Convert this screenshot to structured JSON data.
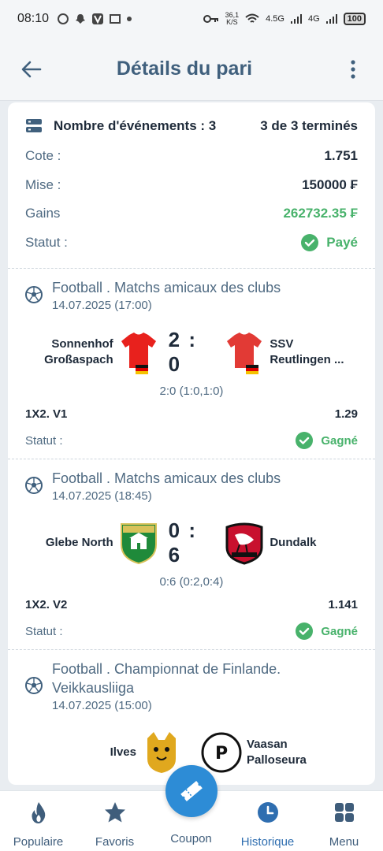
{
  "status_bar": {
    "time": "08:10",
    "net_speed_top": "36,1",
    "net_speed_unit": "K/S",
    "signal_1": "4.5G",
    "signal_2": "4G",
    "battery": "100"
  },
  "header": {
    "title": "Détails du pari"
  },
  "summary": {
    "events_label": "Nombre d'événements : 3",
    "finished_label": "3 de 3 terminés",
    "rows": [
      {
        "label": "Cote :",
        "value": "1.751"
      },
      {
        "label": "Mise :",
        "value": "150000 ₣"
      },
      {
        "label": "Gains",
        "value": "262732.35 ₣"
      }
    ],
    "status_label": "Statut :",
    "status_value": "Payé"
  },
  "events": [
    {
      "title": "Football . Matchs amicaux des clubs",
      "date": "14.07.2025 (17:00)",
      "home": "Sonnenhof Großaspach",
      "away": "SSV Reutlingen ...",
      "score": "2 : 0",
      "detail": "2:0 (1:0,1:0)",
      "bet_type": "1X2. V1",
      "odd": "1.29",
      "status_label": "Statut :",
      "status_value": "Gagné"
    },
    {
      "title": "Football . Matchs amicaux des clubs",
      "date": "14.07.2025 (18:45)",
      "home": "Glebe North",
      "away": "Dundalk",
      "score": "0 : 6",
      "detail": "0:6 (0:2,0:4)",
      "bet_type": "1X2. V2",
      "odd": "1.141",
      "status_label": "Statut :",
      "status_value": "Gagné"
    },
    {
      "title": "Football . Championnat de Finlande. Veikkausliiga",
      "date": "14.07.2025 (15:00)",
      "home": "Ilves",
      "away": "Vaasan Palloseura"
    }
  ],
  "nav": [
    {
      "label": "Populaire",
      "icon": "flame-icon"
    },
    {
      "label": "Favoris",
      "icon": "star-icon"
    },
    {
      "label": "Coupon",
      "icon": "ticket-icon"
    },
    {
      "label": "Historique",
      "icon": "clock-icon"
    },
    {
      "label": "Menu",
      "icon": "grid-icon"
    }
  ],
  "colors": {
    "accent": "#2d8cd6",
    "title": "#40607d",
    "success": "#48b26b",
    "background": "#e9edf1"
  }
}
